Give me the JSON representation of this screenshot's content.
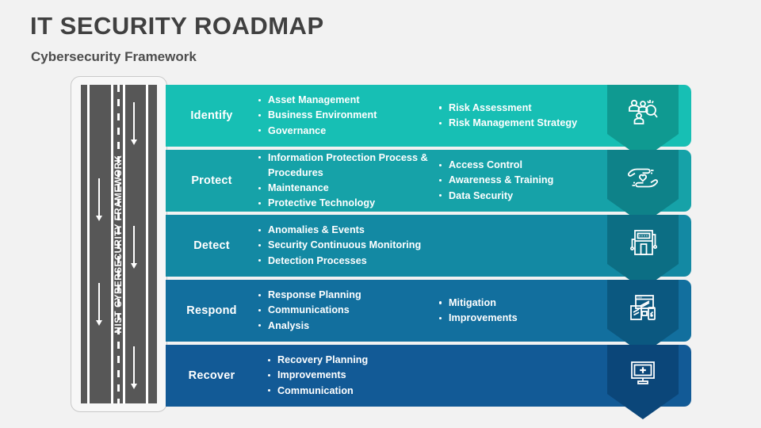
{
  "header": {
    "title": "IT SECURITY ROADMAP",
    "subtitle": "Cybersecurity Framework"
  },
  "road": {
    "label": "NIST CYBERSECURITY FRAMEWORK"
  },
  "colors": {
    "background": "#f2f2f2",
    "title_text": "#404040",
    "road_asphalt": "#575757",
    "row_1": "#17bfb4",
    "row_2": "#16a2a8",
    "row_3": "#1389a3",
    "row_4": "#126f9e",
    "row_5": "#125a96",
    "badge_1": "#0f9a91",
    "badge_2": "#0e8289",
    "badge_3": "#0c6e84",
    "badge_4": "#0b5880",
    "badge_5": "#0b4679"
  },
  "rows": [
    {
      "title": "Identify",
      "icon": "people-search-icon",
      "column_1": [
        "Asset Management",
        "Business Environment",
        "Governance"
      ],
      "column_2": [
        "Risk Assessment",
        "Risk Management Strategy"
      ]
    },
    {
      "title": "Protect",
      "icon": "hands-heart-shield-icon",
      "column_1": [
        "Information Protection Process & Procedures",
        "Maintenance",
        "Protective Technology"
      ],
      "column_2": [
        "Access Control",
        "Awareness & Training",
        "Data Security"
      ]
    },
    {
      "title": "Detect",
      "icon": "scanner-machine-icon",
      "column_1": [
        "Anomalies & Events",
        "Security Continuous Monitoring",
        "Detection Processes"
      ],
      "column_2": []
    },
    {
      "title": "Respond",
      "icon": "devices-screens-icon",
      "column_1": [
        "Response Planning",
        "Communications",
        "Analysis"
      ],
      "column_2": [
        "Mitigation",
        "Improvements"
      ]
    },
    {
      "title": "Recover",
      "icon": "monitor-plus-icon",
      "column_1": [
        "Recovery Planning",
        "Improvements",
        "Communication"
      ],
      "column_2": []
    }
  ]
}
